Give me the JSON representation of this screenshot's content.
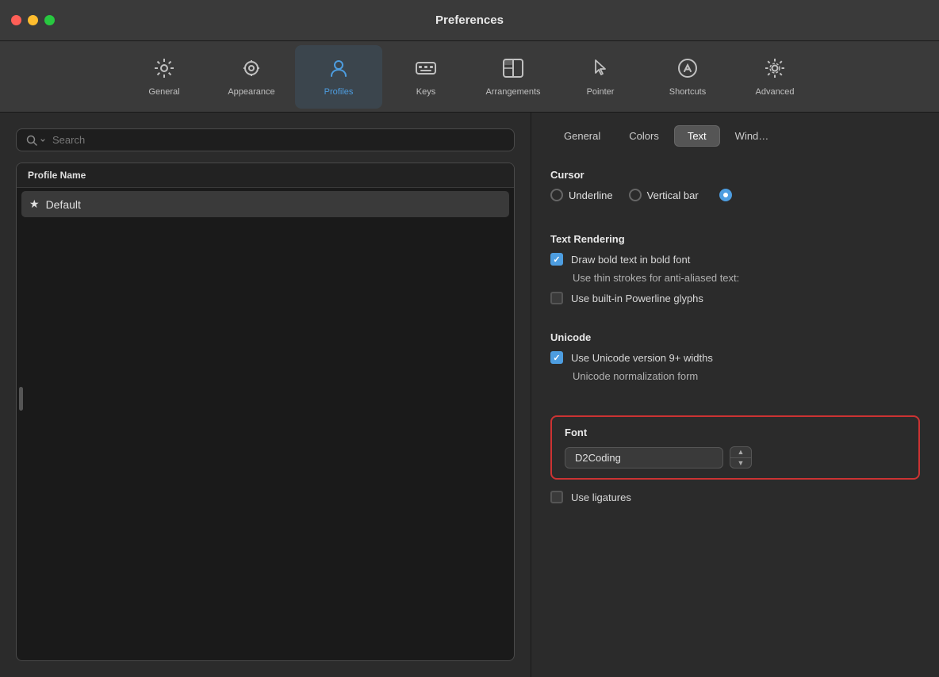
{
  "window": {
    "title": "Preferences"
  },
  "toolbar": {
    "items": [
      {
        "id": "general",
        "label": "General",
        "icon": "⚙️",
        "active": false
      },
      {
        "id": "appearance",
        "label": "Appearance",
        "icon": "👁",
        "active": false
      },
      {
        "id": "profiles",
        "label": "Profiles",
        "icon": "👤",
        "active": true
      },
      {
        "id": "keys",
        "label": "Keys",
        "icon": "⌨️",
        "active": false
      },
      {
        "id": "arrangements",
        "label": "Arrangements",
        "icon": "🪟",
        "active": false
      },
      {
        "id": "pointer",
        "label": "Pointer",
        "icon": "🖱",
        "active": false
      },
      {
        "id": "shortcuts",
        "label": "Shortcuts",
        "icon": "⚡",
        "active": false
      },
      {
        "id": "advanced",
        "label": "Advanced",
        "icon": "⚙️",
        "active": false
      }
    ]
  },
  "left_panel": {
    "search_placeholder": "Search",
    "profile_list_header": "Profile Name",
    "profiles": [
      {
        "name": "Default",
        "is_default": true,
        "selected": true
      }
    ]
  },
  "right_panel": {
    "subtabs": [
      {
        "label": "General",
        "active": false
      },
      {
        "label": "Colors",
        "active": false
      },
      {
        "label": "Text",
        "active": true
      },
      {
        "label": "Wind…",
        "active": false
      }
    ],
    "cursor_section": {
      "title": "Cursor",
      "options": [
        {
          "label": "Underline",
          "checked": false
        },
        {
          "label": "Vertical bar",
          "checked": true
        }
      ]
    },
    "text_rendering_section": {
      "title": "Text Rendering",
      "draw_bold": {
        "label": "Draw bold text in bold font",
        "checked": true
      },
      "thin_strokes": {
        "label": "Use thin strokes for anti-aliased text:"
      },
      "powerline": {
        "label": "Use built-in Powerline glyphs",
        "checked": false
      }
    },
    "unicode_section": {
      "title": "Unicode",
      "unicode_widths": {
        "label": "Use Unicode version 9+ widths",
        "checked": true
      },
      "normalization": {
        "label": "Unicode normalization form"
      }
    },
    "font_section": {
      "title": "Font",
      "font_name": "D2Coding",
      "use_ligatures": {
        "label": "Use ligatures",
        "checked": false
      }
    }
  }
}
